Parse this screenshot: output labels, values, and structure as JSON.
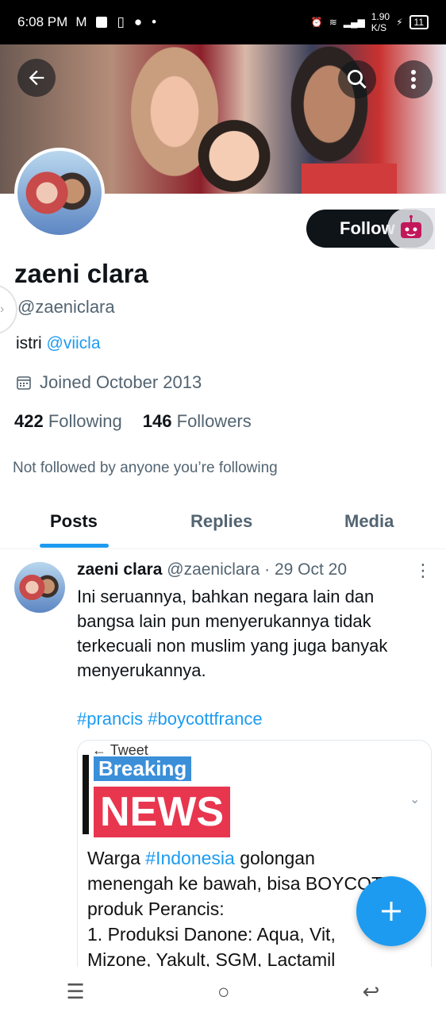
{
  "status_bar": {
    "time": "6:08 PM",
    "net_speed": "1.90",
    "net_unit": "K/S",
    "battery": "11"
  },
  "header": {
    "back_icon": "arrow-left-icon",
    "search_icon": "search-icon",
    "more_icon": "more-vertical-icon"
  },
  "profile": {
    "name": "zaeni clara",
    "handle": "@zaeniclara",
    "bio_text": "istri ",
    "bio_mention": "@viicla",
    "joined": "Joined October 2013",
    "following_count": "422",
    "following_label": "Following",
    "followers_count": "146",
    "followers_label": "Followers",
    "not_followed": "Not followed by anyone you’re following",
    "follow_label": "Follow"
  },
  "tabs": [
    {
      "label": "Posts",
      "active": true
    },
    {
      "label": "Replies",
      "active": false
    },
    {
      "label": "Media",
      "active": false
    }
  ],
  "tweet": {
    "name": "zaeni clara",
    "handle": "@zaeniclara",
    "sep": " · ",
    "date": "29 Oct 20",
    "text": "Ini seruannya, bahkan negara lain dan bangsa lain pun menyerukannya tidak terkecuali non muslim yang juga banyak menyerukannya.",
    "hashtags": "#prancis #boycottfrance",
    "media": {
      "top_label": "Tweet",
      "breaking": "Breaking",
      "news": "NEWS",
      "line1_a": "Warga ",
      "line1_tag": "#Indonesia",
      "line1_b": " golongan",
      "line2": "menengah ke bawah, bisa BOYCOTT",
      "line3": "produk Perancis:",
      "line4": "1. Produksi Danone: Aqua, Vit,",
      "line5": "Mizone, Yakult, SGM, Lactamil"
    }
  },
  "colors": {
    "accent": "#1d9bf0",
    "text": "#0f1419",
    "secondary": "#536471"
  }
}
